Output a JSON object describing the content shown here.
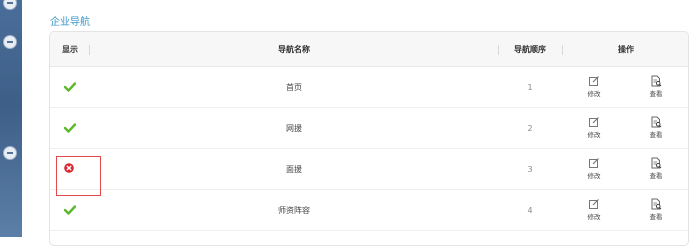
{
  "page": {
    "title": "企业导航"
  },
  "table": {
    "headers": {
      "show": "显示",
      "name": "导航名称",
      "order": "导航顺序",
      "actions": "操作"
    },
    "action_labels": {
      "edit": "修改",
      "view": "查看"
    },
    "rows": [
      {
        "name": "首页",
        "order": "1",
        "visible": true
      },
      {
        "name": "网援",
        "order": "2",
        "visible": true
      },
      {
        "name": "面援",
        "order": "3",
        "visible": false
      },
      {
        "name": "师资阵容",
        "order": "4",
        "visible": true
      }
    ]
  },
  "colors": {
    "accent": "#3a95c8",
    "check": "#5cb82a",
    "error": "#d9262e",
    "highlight": "#e04a4a"
  },
  "icons": {
    "visible": "check-icon",
    "hidden": "x-circle-icon",
    "edit": "edit-icon",
    "view": "view-icon"
  }
}
